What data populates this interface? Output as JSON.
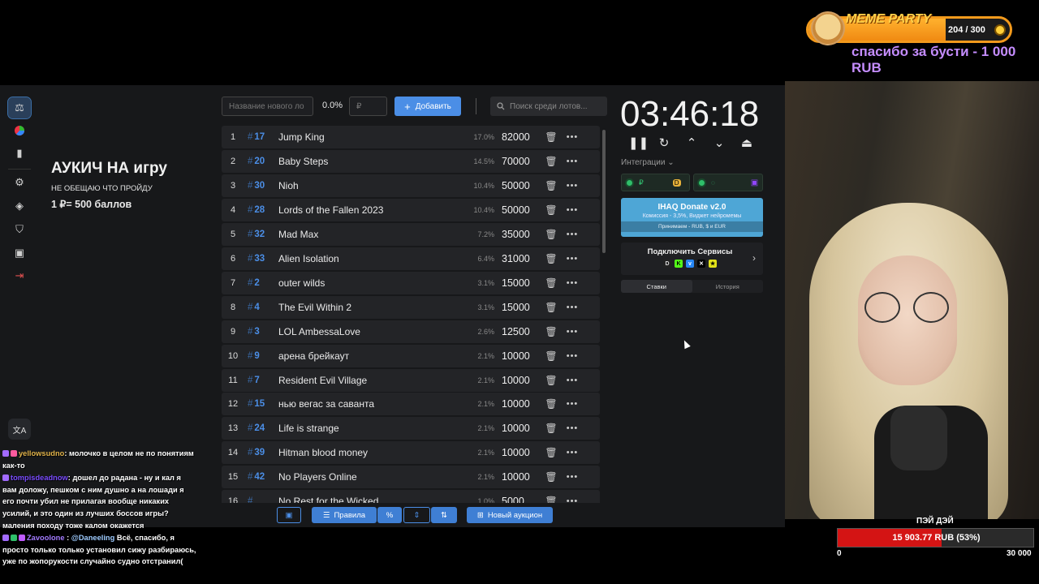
{
  "overlay": {
    "meme_title": "MEME PARTY",
    "meme_count": "204 / 300",
    "meme_progress": 0.68,
    "boost_text": "спасибо за бусти - 1 000 RUB"
  },
  "auction": {
    "title": "АУКИЧ НА игру",
    "subtitle": "НЕ ОБЕЩАЮ ЧТО ПРОЙДУ",
    "rate": "1 ₽= 500 баллов"
  },
  "toolbar": {
    "name_placeholder": "Название нового ло",
    "percent": "0.0%",
    "amount_placeholder": "₽",
    "add_label": "Добавить",
    "search_placeholder": "Поиск среди лотов..."
  },
  "lots": [
    {
      "idx": "1",
      "num": "17",
      "name": "Jump King",
      "share": "17.0%",
      "amount": "82000"
    },
    {
      "idx": "2",
      "num": "20",
      "name": "Baby Steps",
      "share": "14.5%",
      "amount": "70000"
    },
    {
      "idx": "3",
      "num": "30",
      "name": "Nioh",
      "share": "10.4%",
      "amount": "50000"
    },
    {
      "idx": "4",
      "num": "28",
      "name": "Lords of the Fallen 2023",
      "share": "10.4%",
      "amount": "50000"
    },
    {
      "idx": "5",
      "num": "32",
      "name": "Mad Max",
      "share": "7.2%",
      "amount": "35000"
    },
    {
      "idx": "6",
      "num": "33",
      "name": "Alien Isolation",
      "share": "6.4%",
      "amount": "31000"
    },
    {
      "idx": "7",
      "num": "2",
      "name": "outer wilds",
      "share": "3.1%",
      "amount": "15000"
    },
    {
      "idx": "8",
      "num": "4",
      "name": "The Evil Within  2",
      "share": "3.1%",
      "amount": "15000"
    },
    {
      "idx": "9",
      "num": "3",
      "name": "LOL AmbessaLove",
      "share": "2.6%",
      "amount": "12500"
    },
    {
      "idx": "10",
      "num": "9",
      "name": "арена брейкаут",
      "share": "2.1%",
      "amount": "10000"
    },
    {
      "idx": "11",
      "num": "7",
      "name": "Resident Evil Village",
      "share": "2.1%",
      "amount": "10000"
    },
    {
      "idx": "12",
      "num": "15",
      "name": "нью вегас за саванта",
      "share": "2.1%",
      "amount": "10000"
    },
    {
      "idx": "13",
      "num": "24",
      "name": "Life is strange",
      "share": "2.1%",
      "amount": "10000"
    },
    {
      "idx": "14",
      "num": "39",
      "name": "Hitman blood money",
      "share": "2.1%",
      "amount": "10000"
    },
    {
      "idx": "15",
      "num": "42",
      "name": "No Players Online",
      "share": "2.1%",
      "amount": "10000"
    },
    {
      "idx": "16",
      "num": "",
      "name": "No Rest for the Wicked",
      "share": "1.0%",
      "amount": "5000"
    }
  ],
  "bottom": {
    "rules_label": "Правила",
    "new_auction_label": "Новый аукцион"
  },
  "timer": {
    "value": "03:46:18"
  },
  "integrations": {
    "label": "Интеграции",
    "donate_title": "IHAQ Donate v2.0",
    "donate_sub": "Комиссия - 3,5%, Виджет нейромемы",
    "donate_accept": "Принимаем - RUB, $ и EUR",
    "services_title": "Подключить Сервисы",
    "tab_bets": "Ставки",
    "tab_history": "История"
  },
  "chat": [
    {
      "user": "yellowsudno",
      "text": ": молочко в целом не по понятиям как-то"
    },
    {
      "user": "tompisdeadnow",
      "text": ": дошел до радана - ну и кал я вам доложу, пешком с ним душно а на лошади я его почти убил не прилагая вообще никаких усилий, и это один из лучших боссов игры? маления походу тоже калом окажется"
    },
    {
      "user": "Zavoolone",
      "mention": "@Daneeling",
      "text": " Всё, спасибо, я просто только только установил сижу разбираюсь, уже по жопорукости случайно судно отстранил("
    }
  ],
  "goal": {
    "label": "ПЭЙ ДЭЙ",
    "text": "15 903.77 RUB (53%)",
    "progress": 0.53,
    "min": "0",
    "max": "30 000"
  }
}
